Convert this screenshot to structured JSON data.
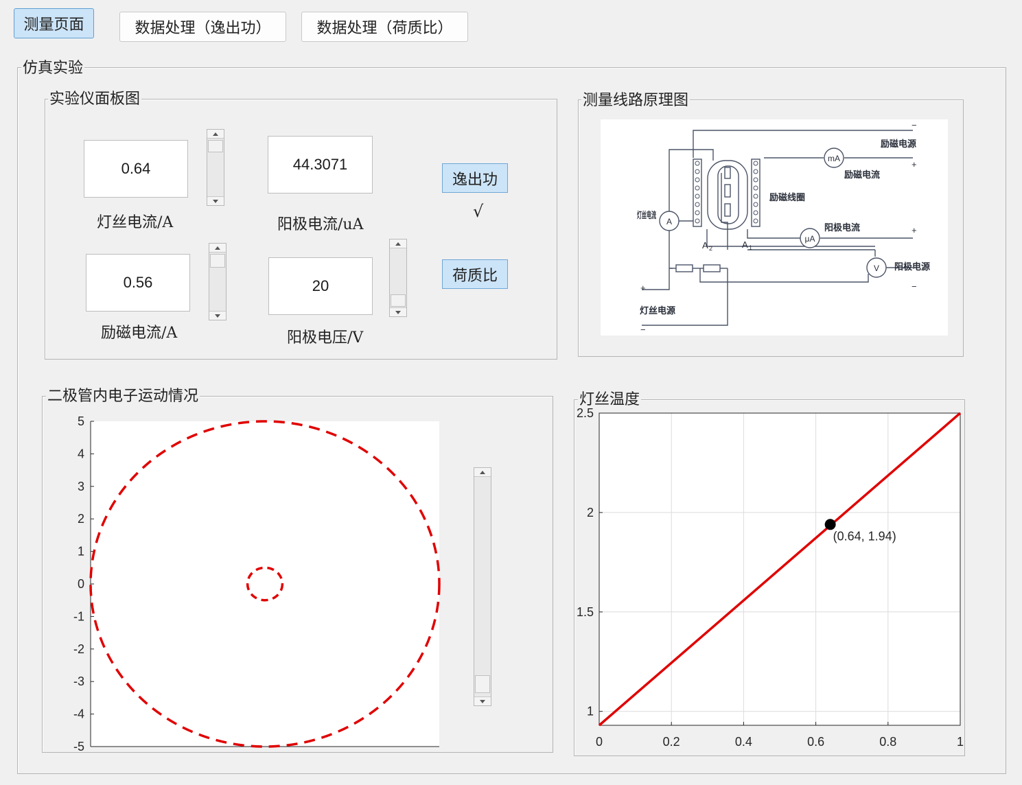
{
  "tabs": [
    {
      "label": "测量页面",
      "active": true
    },
    {
      "label": "数据处理（逸出功）",
      "active": false
    },
    {
      "label": "数据处理（荷质比）",
      "active": false
    }
  ],
  "main_panel": {
    "title": "仿真实验"
  },
  "instrument_panel": {
    "title": "实验仪面板图",
    "filament_current": {
      "value": "0.64",
      "label": "灯丝电流/A"
    },
    "anode_current": {
      "value": "44.3071",
      "label": "阳极电流/uA"
    },
    "excitation_current": {
      "value": "0.56",
      "label": "励磁电流/A"
    },
    "anode_voltage": {
      "value": "20",
      "label": "阳极电压/V"
    },
    "work_function_button": "逸出功",
    "work_function_check": "√",
    "charge_mass_button": "荷质比"
  },
  "circuit_panel": {
    "title": "测量线路原理图",
    "labels": {
      "excitation_supply": "励磁电源",
      "excitation_current": "励磁电流",
      "excitation_coil": "励磁线圈",
      "filament_current": "灯丝电流",
      "anode_current": "阳极电流",
      "anode_supply": "阳极电源",
      "filament_supply": "灯丝电源",
      "meter_mA": "mA",
      "meter_uA": "μA",
      "meter_A": "A",
      "meter_V": "V",
      "a1": "A",
      "a1_sub": "1",
      "a2": "A",
      "a2_sub": "2",
      "plus": "+",
      "minus": "−"
    }
  },
  "motion_panel": {
    "title": "二极管内电子运动情况",
    "y_ticks": [
      "5",
      "4",
      "3",
      "2",
      "1",
      "0",
      "-1",
      "-2",
      "-3",
      "-4",
      "-5"
    ],
    "scroll_fraction": 0.9
  },
  "temperature_panel": {
    "title": "灯丝温度"
  },
  "chart_data": [
    {
      "type": "scatter",
      "title": "",
      "xlabel": "",
      "ylabel": "",
      "xlim": [
        -5,
        5
      ],
      "ylim": [
        -5,
        5
      ],
      "grid": false,
      "series": [
        {
          "style": "dashed-circle",
          "color": "#e00000",
          "center": [
            0,
            0
          ],
          "radius": 5
        },
        {
          "style": "dashed-circle",
          "color": "#e00000",
          "center": [
            0,
            0
          ],
          "radius": 0.5
        }
      ]
    },
    {
      "type": "line",
      "title": "",
      "xlabel": "",
      "ylabel": "",
      "xlim": [
        0,
        1
      ],
      "ylim": [
        0.93,
        2.5
      ],
      "x_ticks": [
        "0",
        "0.2",
        "0.4",
        "0.6",
        "0.8",
        "1"
      ],
      "y_ticks": [
        "1",
        "1.5",
        "2",
        "2.5"
      ],
      "grid": true,
      "series": [
        {
          "color": "#e00000",
          "x": [
            0,
            1
          ],
          "y": [
            0.93,
            2.5
          ]
        }
      ],
      "marker": {
        "x": 0.64,
        "y": 1.94,
        "label": "(0.64, 1.94)"
      }
    }
  ]
}
